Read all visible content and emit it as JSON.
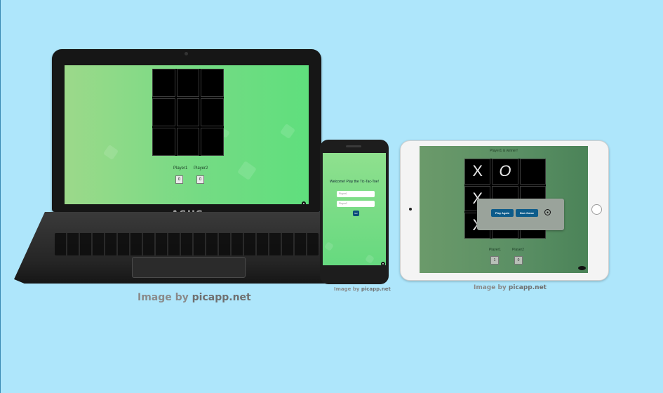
{
  "laptop": {
    "brand": "ASUS",
    "scoreboard": {
      "player1_label": "Player1",
      "player2_label": "Player2",
      "player1_score": "0",
      "player2_score": "0"
    },
    "caption_prefix": "Image by ",
    "caption_site": "picapp.net"
  },
  "phone": {
    "title": "Welcome! Play the Tic-Tac-Toe!",
    "player1_placeholder": "Player1",
    "player2_placeholder": "Player2",
    "button_label": "Go!",
    "caption_prefix": "Image by ",
    "caption_site": "picapp.net"
  },
  "tablet": {
    "status": "Player1 is winner!",
    "board": [
      "X",
      "O",
      "",
      "X",
      "",
      "",
      "X",
      "",
      ""
    ],
    "modal": {
      "play_again_label": "Play Again",
      "new_game_label": "New Game"
    },
    "scoreboard": {
      "player1_label": "Player1",
      "player2_label": "Player2",
      "player1_score": "1",
      "player2_score": "0"
    },
    "caption_prefix": "Image by ",
    "caption_site": "picapp.net"
  },
  "icons": {
    "github": "github-icon",
    "eye": "eye-icon"
  },
  "colors": {
    "background": "#aee6fb",
    "button": "#0c5b8a",
    "laptop_screen_start": "#9cd98a",
    "laptop_screen_end": "#5fdf7d"
  }
}
